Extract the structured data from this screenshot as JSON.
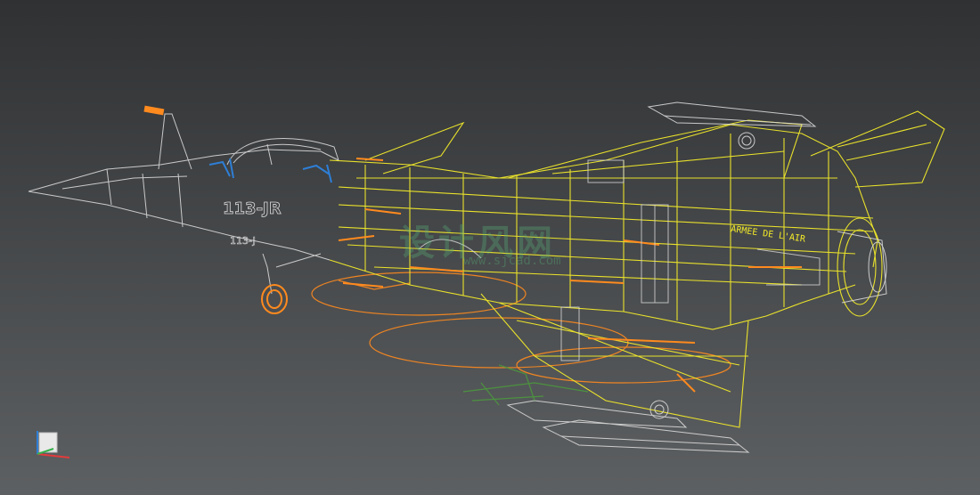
{
  "viewport": {
    "background_top": "#2f3133",
    "background_bottom": "#5d6062",
    "colors": {
      "wire_selected": "#f2ea2a",
      "wire_default": "#d9d9d9",
      "accent_orange": "#ff8a1e",
      "accent_blue": "#2e7fd6",
      "accent_green": "#4aa13a"
    }
  },
  "model": {
    "markings": {
      "serial": "113-JR",
      "serial_short": "113-J",
      "tail_text": "ARMEE DE L'AIR"
    },
    "watermark": {
      "brand": "设计风网",
      "url": "www.sjcad.com"
    }
  },
  "gizmo": {
    "axes": [
      "x-axis-icon",
      "y-axis-icon",
      "z-axis-icon"
    ]
  }
}
